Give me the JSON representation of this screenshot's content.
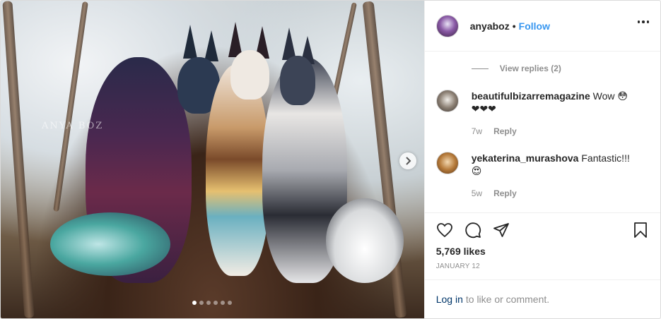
{
  "header": {
    "username": "anyaboz",
    "separator": "•",
    "follow_label": "Follow"
  },
  "photo": {
    "watermark": "ANYA BOZ",
    "dots_total": 6,
    "dots_active": 1
  },
  "comments": {
    "view_replies": "View replies (2)",
    "items": [
      {
        "username": "beautifulbizarremagazine",
        "text": "Wow 😳",
        "text2": "❤❤❤",
        "age": "7w",
        "reply_label": "Reply"
      },
      {
        "username": "yekaterina_murashova",
        "text": "Fantastic!!!",
        "text2": "😍",
        "age": "5w",
        "reply_label": "Reply"
      }
    ]
  },
  "actions": {
    "likes": "5,769 likes",
    "date": "JANUARY 12"
  },
  "login": {
    "link": "Log in",
    "rest": "to like or comment."
  },
  "colors": {
    "accent": "#3897f0",
    "link_dark": "#003569",
    "muted": "#8e8e8e"
  }
}
